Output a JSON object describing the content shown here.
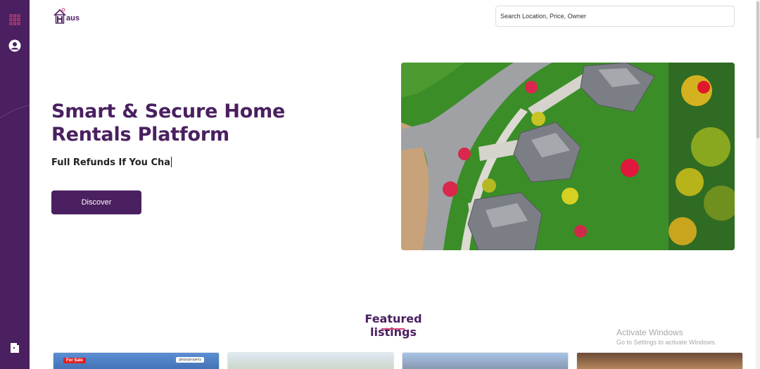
{
  "app": {
    "logo_text": "aus"
  },
  "search": {
    "placeholder": "Search Location, Price, Owner"
  },
  "hero": {
    "title": "Smart & Secure Home Rentals Platform",
    "subtitle": "Full Refunds If You Cha",
    "button_label": "Discover"
  },
  "featured": {
    "heading": "Featured listings",
    "cards": [
      {
        "badge": "For Sale",
        "brand": "giropsproperty"
      },
      {},
      {},
      {}
    ]
  },
  "sidebar": {
    "icons": [
      "grid-icon",
      "user-icon",
      "logout-icon"
    ]
  },
  "watermark": {
    "line1": "Activate Windows",
    "line2": "Go to Settings to activate Windows."
  },
  "colors": {
    "brand": "#4a2060",
    "accent": "#d9467a",
    "grass": "#3b9a2a"
  }
}
